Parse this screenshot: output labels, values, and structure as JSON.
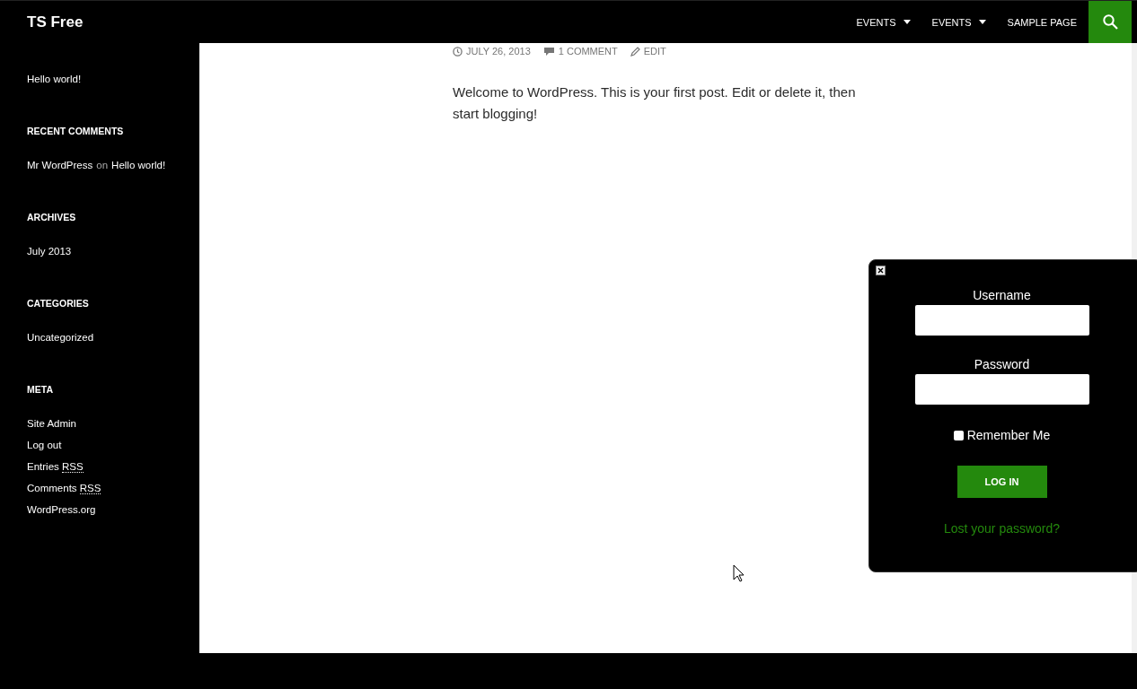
{
  "site_title": "TS Free",
  "nav": [
    {
      "label": "EVENTS",
      "dropdown": true
    },
    {
      "label": "EVENTS",
      "dropdown": true
    },
    {
      "label": "SAMPLE PAGE",
      "dropdown": false
    }
  ],
  "sidebar": {
    "recent_posts": [
      "Hello world!"
    ],
    "recent_comments": {
      "title": "RECENT COMMENTS",
      "items": [
        {
          "author": "Mr WordPress",
          "connector": "on",
          "post": "Hello world!"
        }
      ]
    },
    "archives": {
      "title": "ARCHIVES",
      "items": [
        "July 2013"
      ]
    },
    "categories": {
      "title": "CATEGORIES",
      "items": [
        "Uncategorized"
      ]
    },
    "meta": {
      "title": "META",
      "items": [
        {
          "text": "Site Admin"
        },
        {
          "text": "Log out"
        },
        {
          "text": "Entries",
          "abbr": "RSS"
        },
        {
          "text": "Comments",
          "abbr": "RSS"
        },
        {
          "text": "WordPress.org"
        }
      ]
    }
  },
  "post": {
    "date": "JULY 26, 2013",
    "comments": "1 COMMENT",
    "edit": "EDIT",
    "body": "Welcome to WordPress. This is your first post. Edit or delete it, then start blogging!"
  },
  "login": {
    "username_label": "Username",
    "password_label": "Password",
    "remember": {
      "label": "Remember Me",
      "checked": false
    },
    "button": "LOG IN",
    "lost_password": "Lost your password?"
  }
}
